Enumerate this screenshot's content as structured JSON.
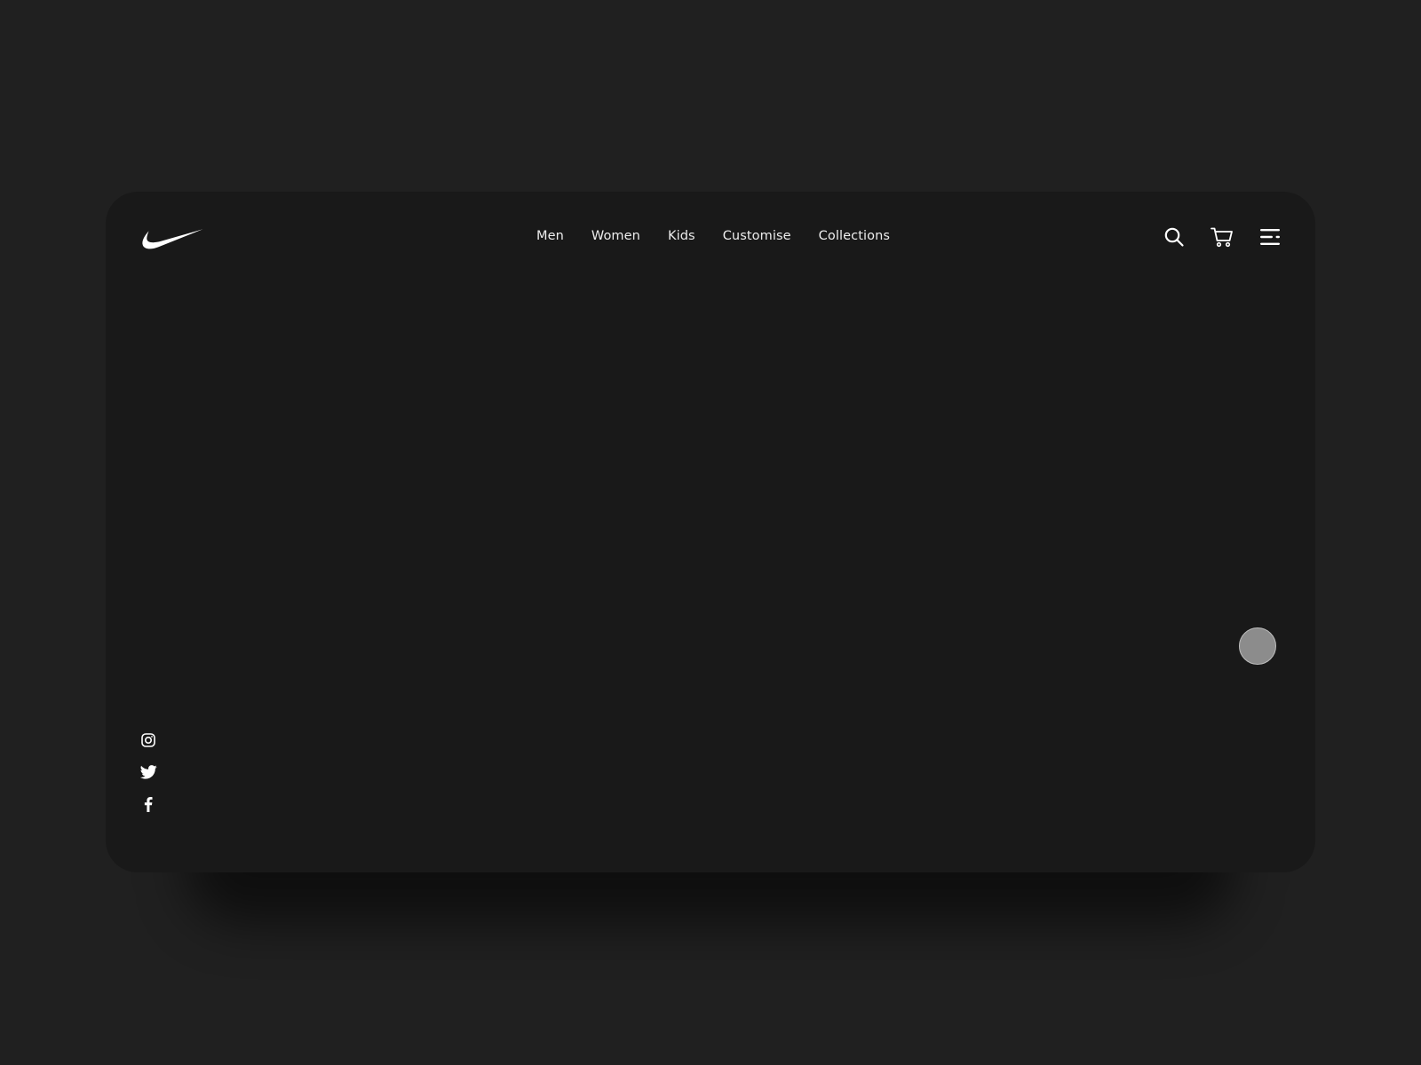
{
  "brand": {
    "logo_icon": "swoosh-logo-icon",
    "logo_color": "#ffffff"
  },
  "nav": {
    "items": [
      {
        "label": "Men"
      },
      {
        "label": "Women"
      },
      {
        "label": "Kids"
      },
      {
        "label": "Customise"
      },
      {
        "label": "Collections"
      }
    ]
  },
  "actions": {
    "search_icon": "search-icon",
    "cart_icon": "cart-icon",
    "menu_icon": "menu-icon"
  },
  "social": {
    "items": [
      {
        "icon": "instagram-icon"
      },
      {
        "icon": "twitter-icon"
      },
      {
        "icon": "facebook-icon"
      }
    ]
  },
  "colors": {
    "page_background": "#202020",
    "card_background": "#191919",
    "text": "#ededed",
    "slider_dot": "#8c8c8c"
  }
}
